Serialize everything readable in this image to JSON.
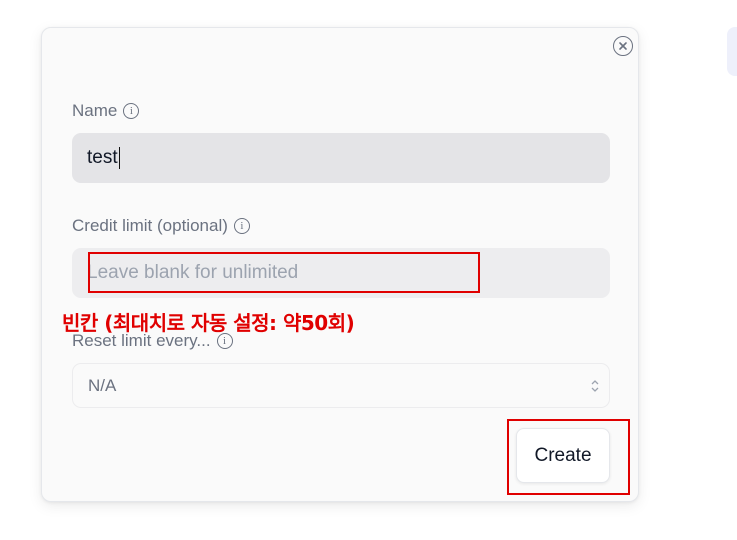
{
  "dialog": {
    "name_label": "Name",
    "name_value": "test",
    "credit_label": "Credit limit (optional)",
    "credit_placeholder": "Leave blank for unlimited",
    "reset_label": "Reset limit every...",
    "reset_value": "N/A",
    "create_label": "Create"
  },
  "annotation": {
    "note": "빈칸 (최대치로 자동 설정: 약50회)",
    "color": "#e00000"
  },
  "icons": {
    "close": "close-circle-icon",
    "info": "info-icon",
    "select": "chevron-up-down-icon"
  }
}
